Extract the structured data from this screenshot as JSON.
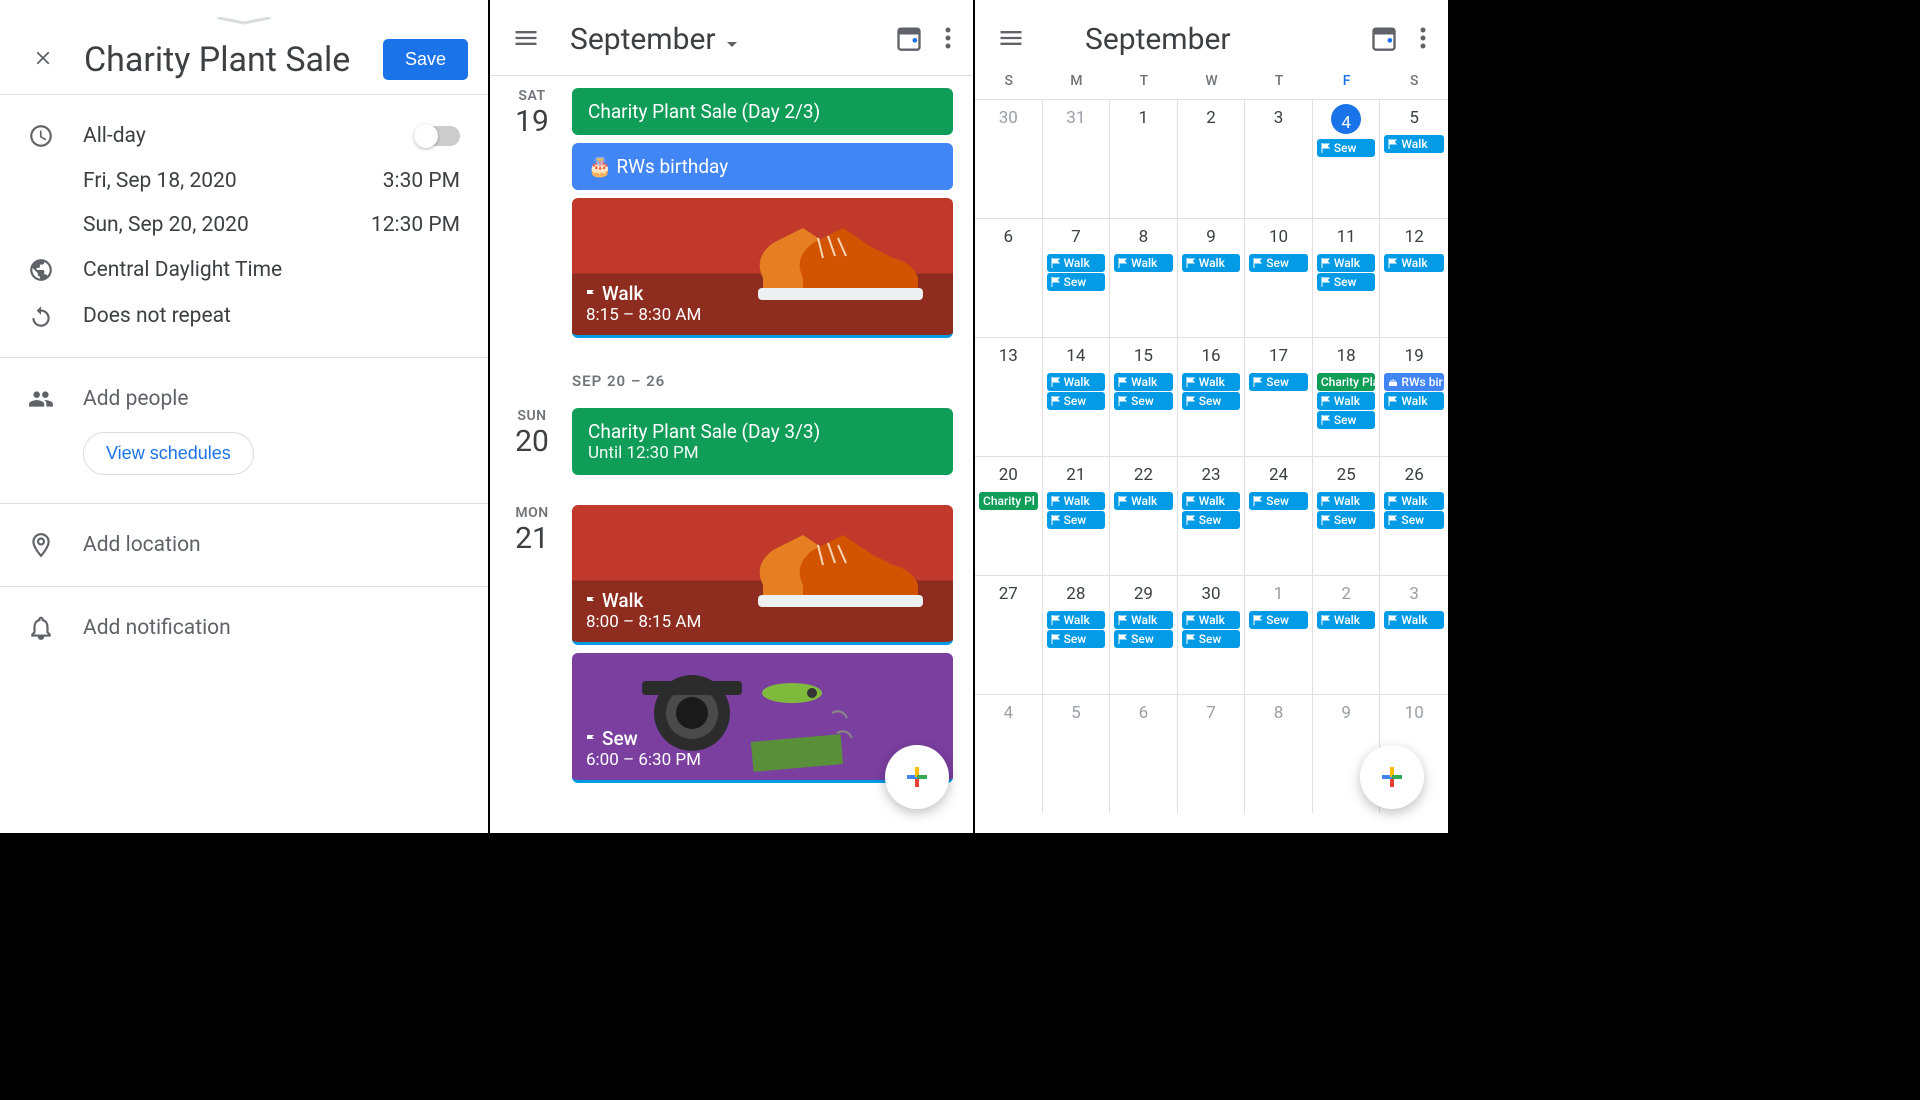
{
  "panel1": {
    "title": "Charity Plant Sale",
    "save_label": "Save",
    "allday_label": "All-day",
    "start_date": "Fri, Sep 18, 2020",
    "start_time": "3:30 PM",
    "end_date": "Sun, Sep 20, 2020",
    "end_time": "12:30 PM",
    "timezone": "Central Daylight Time",
    "repeat": "Does not repeat",
    "add_people": "Add people",
    "view_schedules": "View schedules",
    "add_location": "Add location",
    "add_notification": "Add notification"
  },
  "panel2": {
    "month": "September",
    "days": [
      {
        "dow": "SAT",
        "num": "19"
      },
      {
        "dow": "SUN",
        "num": "20"
      },
      {
        "dow": "MON",
        "num": "21"
      }
    ],
    "week_header": "SEP 20 – 26",
    "events": {
      "d19_sale": "Charity Plant Sale (Day 2/3)",
      "d19_bday": "RWs birthday",
      "d19_walk": "Walk",
      "d19_walk_time": "8:15 – 8:30 AM",
      "d20_sale": "Charity Plant Sale (Day 3/3)",
      "d20_sale_sub": "Until 12:30 PM",
      "d21_walk": "Walk",
      "d21_walk_time": "8:00 – 8:15 AM",
      "d21_sew": "Sew",
      "d21_sew_time": "6:00 – 6:30 PM"
    }
  },
  "panel3": {
    "month": "September",
    "dow": [
      "S",
      "M",
      "T",
      "W",
      "T",
      "F",
      "S"
    ],
    "labels": {
      "walk": "Walk",
      "sew": "Sew",
      "charity": "Charity Plant Sale",
      "charity_short": "Charity Pl",
      "rws": "RWs bir"
    },
    "weeks": [
      {
        "nums": [
          "30",
          "31",
          "1",
          "2",
          "3",
          "4",
          "5"
        ],
        "muted": [
          0,
          1
        ],
        "today": 5,
        "cells": [
          [],
          [],
          [],
          [],
          [],
          [
            {
              "t": "sew"
            }
          ],
          [
            {
              "t": "walk"
            }
          ]
        ]
      },
      {
        "nums": [
          "6",
          "7",
          "8",
          "9",
          "10",
          "11",
          "12"
        ],
        "cells": [
          [],
          [
            {
              "t": "walk"
            },
            {
              "t": "sew"
            }
          ],
          [
            {
              "t": "walk"
            }
          ],
          [
            {
              "t": "walk"
            }
          ],
          [
            {
              "t": "sew"
            }
          ],
          [
            {
              "t": "walk"
            },
            {
              "t": "sew"
            }
          ],
          [
            {
              "t": "walk"
            }
          ]
        ]
      },
      {
        "nums": [
          "13",
          "14",
          "15",
          "16",
          "17",
          "18",
          "19"
        ],
        "cells": [
          [],
          [
            {
              "t": "walk"
            },
            {
              "t": "sew"
            }
          ],
          [
            {
              "t": "walk"
            },
            {
              "t": "sew"
            }
          ],
          [
            {
              "t": "walk"
            },
            {
              "t": "sew"
            }
          ],
          [
            {
              "t": "sew"
            }
          ],
          [
            {
              "t": "charity",
              "c": "green"
            },
            {
              "t": "walk"
            },
            {
              "t": "sew"
            }
          ],
          [
            {
              "t": "rws",
              "c": "blue-cake"
            },
            {
              "t": "walk"
            }
          ]
        ]
      },
      {
        "nums": [
          "20",
          "21",
          "22",
          "23",
          "24",
          "25",
          "26"
        ],
        "cells": [
          [
            {
              "t": "charity_short",
              "c": "green"
            }
          ],
          [
            {
              "t": "walk"
            },
            {
              "t": "sew"
            }
          ],
          [
            {
              "t": "walk"
            }
          ],
          [
            {
              "t": "walk"
            },
            {
              "t": "sew"
            }
          ],
          [
            {
              "t": "sew"
            }
          ],
          [
            {
              "t": "walk"
            },
            {
              "t": "sew"
            }
          ],
          [
            {
              "t": "walk"
            },
            {
              "t": "sew"
            }
          ]
        ]
      },
      {
        "nums": [
          "27",
          "28",
          "29",
          "30",
          "1",
          "2",
          "3"
        ],
        "muted": [
          4,
          5,
          6
        ],
        "cells": [
          [],
          [
            {
              "t": "walk"
            },
            {
              "t": "sew"
            }
          ],
          [
            {
              "t": "walk"
            },
            {
              "t": "sew"
            }
          ],
          [
            {
              "t": "walk"
            },
            {
              "t": "sew"
            }
          ],
          [
            {
              "t": "sew"
            }
          ],
          [
            {
              "t": "walk"
            }
          ],
          [
            {
              "t": "walk"
            }
          ]
        ]
      },
      {
        "nums": [
          "4",
          "5",
          "6",
          "7",
          "8",
          "9",
          "10"
        ],
        "muted": [
          0,
          1,
          2,
          3,
          4,
          5,
          6
        ],
        "cells": [
          [],
          [],
          [],
          [],
          [],
          [],
          []
        ]
      }
    ]
  }
}
